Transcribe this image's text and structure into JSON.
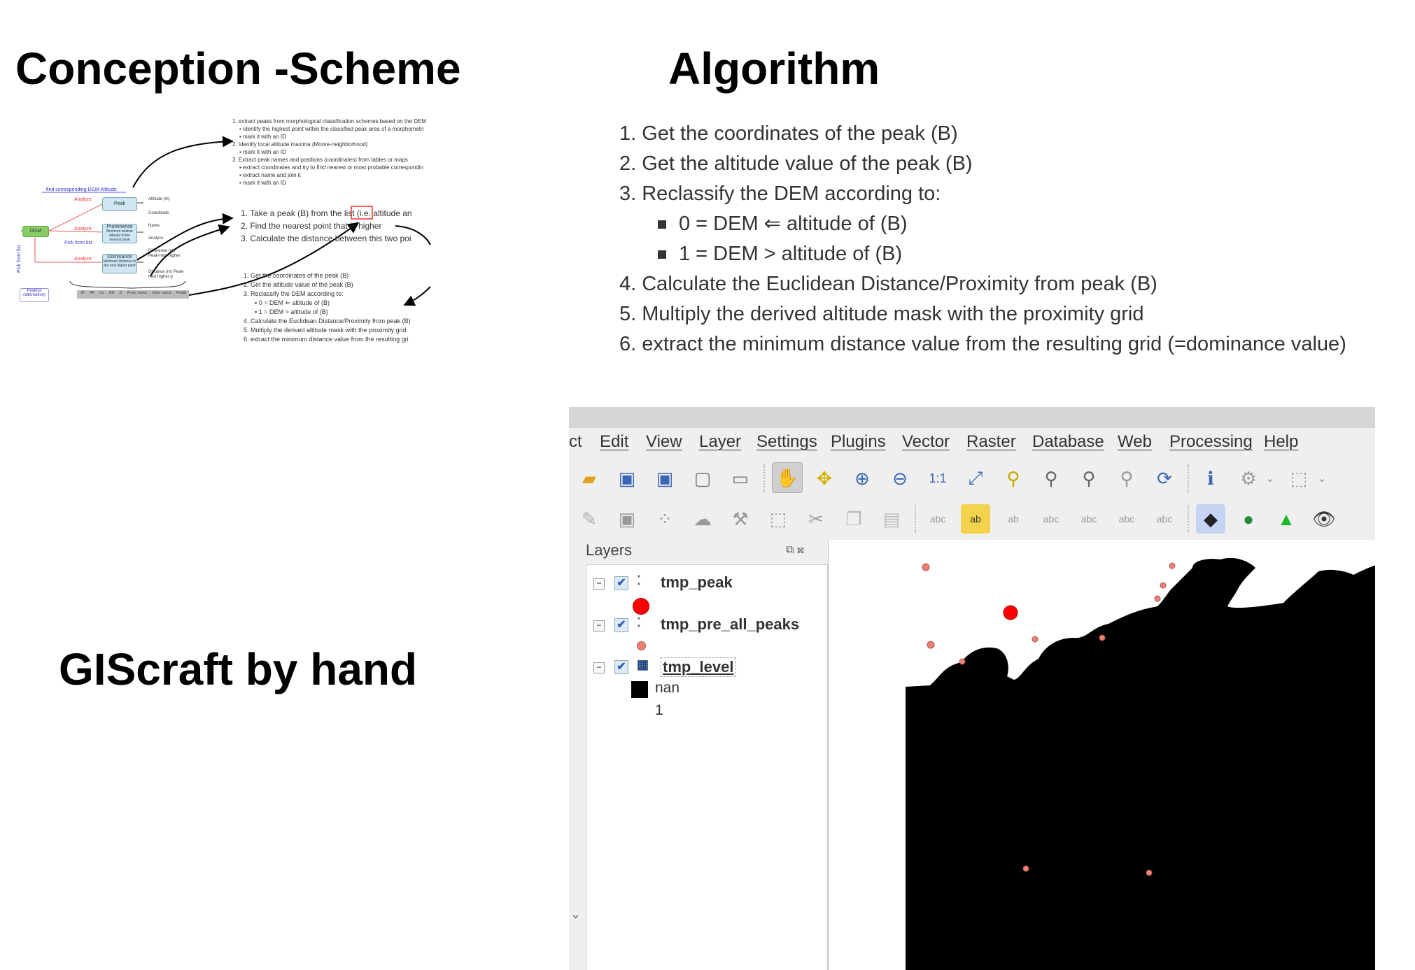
{
  "headings": {
    "conception": "Conception -Scheme",
    "algorithm": "Algorithm",
    "giscraft": "GIScraft by hand"
  },
  "algorithm_steps": [
    "1. Get the coordinates of the peak (B)",
    "2. Get the altitude value of the peak (B)",
    "3. Reclassify the DEM according to:",
    "0 = DEM ⇐ altitude of (B)",
    "1 = DEM > altitude of (B)",
    "4. Calculate the Euclidean Distance/Proximity from peak (B)",
    "5. Multiply the derived altitude mask with the proximity grid",
    "6. extract the minimum distance value from the resulting grid (=dominance value)"
  ],
  "scheme": {
    "top_notes": [
      "1. extract peaks from morphological classification schemes based on the DEM",
      "▪ Identify the highest point within the classified peak area of a morphometri",
      "▪ mark it with an ID",
      "2. Identify local altitude maxima (Moore-neighborhood)",
      "▪ mark it with an ID",
      "3. Extract peak names and positions (coordinates) from tables or maps",
      "▪ extract coordinates and try to find nearest or most probable correspondin",
      "▪ extract name and join it",
      "▪ mark it with an ID"
    ],
    "mid_notes": [
      "1. Take a peak (B) from the list (i.e. altitude an",
      "2. Find the nearest point that is higher",
      "3. Calculate the distance between this two poi"
    ],
    "bottom_notes": [
      "1. Get the coordinates of the peak (B)",
      "2. Get the altitude value of the peak (B)",
      "3. Reclassify the DEM according to:",
      "▪ 0 = DEM ⇐ altitude of (B)",
      "▪ 1 = DEM > altitude of (B)",
      "4. Calculate the Euclidean Distance/Proximity from peak (B)",
      "5. Multiply the derived altitude mask with the proximity grid",
      "6. extract the minimum distance value from the resulting gri"
    ],
    "diagram_labels": {
      "find_dgm": "find corresponding DGM Altitude",
      "dgm": "DGM",
      "analyze": "Analyze",
      "pick_from_list": "Pick from list",
      "pick_from_list_vertical": "Pick from list",
      "peaklist": "Peaklist (alternative)",
      "peak": "Peak",
      "prominence": "Prominence",
      "prominence_sub": "Minimum relative altitude to the nearest peak",
      "dominance": "Dominance",
      "dominance_sub": "Minimum Distance to the next higher point",
      "altitude": "Altitude (m)",
      "coordinate": "Coordinate",
      "name": "Name",
      "analyze_small": "Analyze",
      "difference": "Difference (m) Peak-next higher",
      "distance": "Distance (m) Peak-next higher p",
      "table_cols": [
        "ID",
        "PA",
        "Co",
        "DH",
        "D",
        "Prom.\nnance",
        "Dom.\nnance",
        "Peakb"
      ]
    }
  },
  "qgis": {
    "menu": [
      "ct",
      "Edit",
      "View",
      "Layer",
      "Settings",
      "Plugins",
      "Vector",
      "Raster",
      "Database",
      "Web",
      "Processing",
      "Help"
    ],
    "toolbar1_icons": [
      "open-project-icon",
      "save-project-icon",
      "save-as-icon",
      "new-print-layout-icon",
      "layout-manager-icon",
      "pan-icon",
      "pan-to-selection-icon",
      "zoom-in-icon",
      "zoom-out-icon",
      "zoom-native-icon",
      "zoom-full-icon",
      "zoom-to-selection-icon",
      "zoom-to-layer-icon",
      "zoom-last-icon",
      "zoom-next-icon",
      "refresh-icon",
      "identify-icon",
      "action-icon",
      "select-icon"
    ],
    "toolbar2_icons": [
      "edit-pencil-icon",
      "save-edits-icon",
      "digitize-icon",
      "add-feature-icon",
      "vertex-tool-icon",
      "delete-selected-icon",
      "cut-icon",
      "copy-icon",
      "paste-icon",
      "label-icon",
      "label-pin-icon",
      "label-highlight-icon",
      "label-show-icon",
      "label-move-icon",
      "label-rotate-icon",
      "label-change-icon",
      "layer-style-icon",
      "globe-icon",
      "terrain-icon",
      "eye-icon"
    ],
    "layers_title": "Layers",
    "layers": [
      {
        "name": "tmp_peak",
        "type": "point",
        "symbol_color": "#ff0000"
      },
      {
        "name": "tmp_pre_all_peaks",
        "type": "point",
        "symbol_color": "#f08070"
      },
      {
        "name": "tmp_level",
        "type": "raster",
        "legend": [
          "nan",
          "1"
        ]
      }
    ],
    "map_colors": {
      "raster": "#000000",
      "peak": "#ff0000",
      "all_peaks": "#f08070"
    }
  }
}
